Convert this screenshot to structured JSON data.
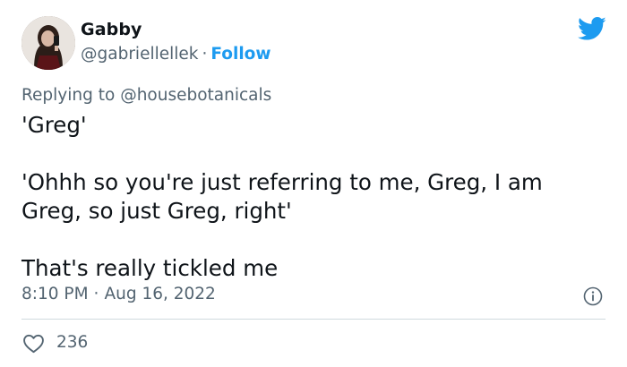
{
  "author": {
    "display_name": "Gabby",
    "handle": "@gabriellellek",
    "separator": "·",
    "follow_label": "Follow"
  },
  "reply": {
    "prefix": "Replying to",
    "mention": "@housebotanicals"
  },
  "tweet": {
    "paragraphs": [
      "'Greg'",
      "'Ohhh so you're just referring to me, Greg, I am Greg, so just Greg, right'",
      "That's really tickled me"
    ]
  },
  "meta": {
    "time": "8:10 PM",
    "separator": "·",
    "date": "Aug 16, 2022"
  },
  "engagement": {
    "likes": "236"
  },
  "icons": {
    "brand": "twitter-bird-icon",
    "info": "info-icon",
    "like": "heart-icon",
    "avatar": "avatar"
  },
  "colors": {
    "accent": "#1d9bf0",
    "text_primary": "#0f1419",
    "text_secondary": "#536471",
    "divider": "#cfd9de"
  }
}
